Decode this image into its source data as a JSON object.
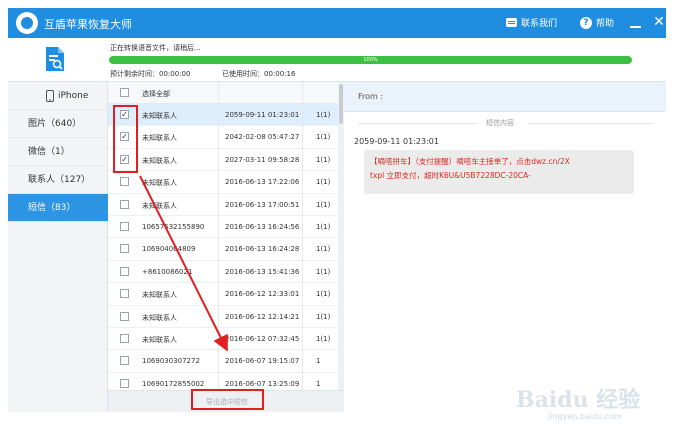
{
  "app": {
    "title": "互盾苹果恢复大师",
    "contact_label": "联系我们",
    "help_label": "帮助",
    "icons": {
      "logo": "app-logo",
      "contact": "chat-icon",
      "help": "question-circle-icon",
      "minimize": "minimize-icon",
      "close": "close-icon"
    }
  },
  "progress": {
    "status_text": "正在转换语音文件，请稍后...",
    "percent": 100,
    "percent_label": "100%",
    "remaining_time": "预计剩余时间：00:00:00",
    "used_time": "已使用时间：00:00:16"
  },
  "sidebar": {
    "items": [
      {
        "label": "iPhone",
        "icon": "phone-icon",
        "active": false
      },
      {
        "label": "图片（640）",
        "active": false
      },
      {
        "label": "微信（1）",
        "active": false
      },
      {
        "label": "联系人（127）",
        "active": false
      },
      {
        "label": "短信（83）",
        "active": true
      }
    ]
  },
  "message_list": {
    "select_all_label": "选择全部",
    "rows": [
      {
        "name": "未知联系人",
        "date": "2059-09-11 01:23:01",
        "count": "1(1)",
        "checked": true
      },
      {
        "name": "未知联系人",
        "date": "2042-02-08 05:47:27",
        "count": "1(1)",
        "checked": true
      },
      {
        "name": "未知联系人",
        "date": "2027-03-11 09:58:28",
        "count": "1(1)",
        "checked": true
      },
      {
        "name": "未知联系人",
        "date": "2016-06-13 17:22:06",
        "count": "1(1)",
        "checked": false
      },
      {
        "name": "未知联系人",
        "date": "2016-06-13 17:00:51",
        "count": "1(1)",
        "checked": false
      },
      {
        "name": "10657532155890",
        "date": "2016-06-13 16:24:56",
        "count": "1(1)",
        "checked": false
      },
      {
        "name": "106904064809",
        "date": "2016-06-13 16:24:28",
        "count": "1(1)",
        "checked": false
      },
      {
        "name": "+8610086021",
        "date": "2016-06-13 15:41:36",
        "count": "1(1)",
        "checked": false
      },
      {
        "name": "未知联系人",
        "date": "2016-06-12 12:33:01",
        "count": "1(1)",
        "checked": false
      },
      {
        "name": "未知联系人",
        "date": "2016-06-12 12:14:21",
        "count": "1(1)",
        "checked": false
      },
      {
        "name": "未知联系人",
        "date": "2016-06-12 07:32:45",
        "count": "1(1)",
        "checked": false
      },
      {
        "name": "1069030307272",
        "date": "2016-06-07 19:15:07",
        "count": "1",
        "checked": false
      },
      {
        "name": "10690172855002",
        "date": "2016-06-07 13:25:09",
        "count": "1",
        "checked": false
      }
    ],
    "export_label": "导出选中短信"
  },
  "detail": {
    "from_label": "From :",
    "section_label": "短信内容",
    "message_time": "2059-09-11 01:23:01",
    "message_line1": "【嘀嗒拼车】（支付提醒）嘀嗒车主接单了，点击dwz.cn/2X",
    "message_line2": "txpl 立即支付，超时K6U&U5B7228DC-20CA-"
  },
  "watermark": {
    "text": "Baidu 经验",
    "sub": "jingyan.baidu.com"
  },
  "colors": {
    "titlebar": "#1f8de0",
    "sidebar_active": "#2d95e3",
    "progress": "#3cc044",
    "message_text": "#d9281f",
    "annotation": "#e02020"
  }
}
